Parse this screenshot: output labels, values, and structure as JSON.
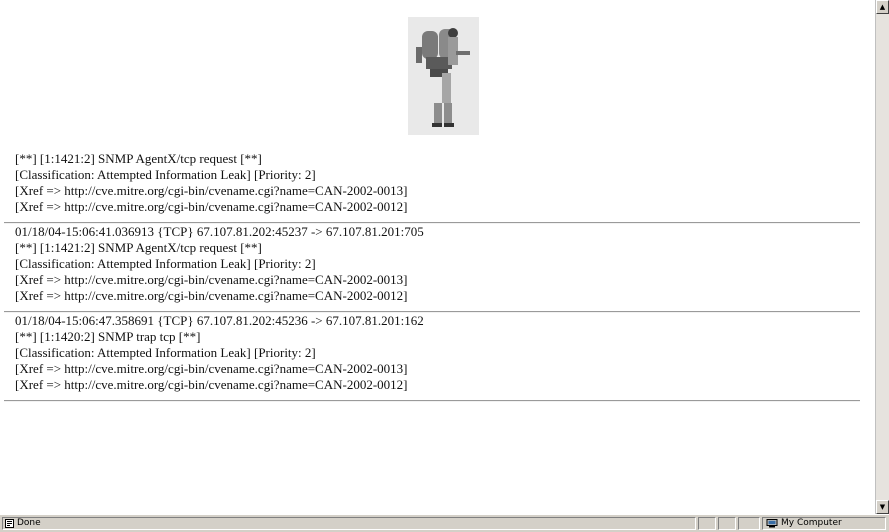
{
  "alerts": [
    {
      "lines": [
        "[**] [1:1421:2] SNMP AgentX/tcp request [**]",
        "[Classification: Attempted Information Leak] [Priority: 2]",
        "[Xref => http://cve.mitre.org/cgi-bin/cvename.cgi?name=CAN-2002-0013]",
        "[Xref => http://cve.mitre.org/cgi-bin/cvename.cgi?name=CAN-2002-0012]"
      ]
    },
    {
      "lines": [
        "01/18/04-15:06:41.036913 {TCP} 67.107.81.202:45237 -> 67.107.81.201:705",
        "[**] [1:1421:2] SNMP AgentX/tcp request [**]",
        "[Classification: Attempted Information Leak] [Priority: 2]",
        "[Xref => http://cve.mitre.org/cgi-bin/cvename.cgi?name=CAN-2002-0013]",
        "[Xref => http://cve.mitre.org/cgi-bin/cvename.cgi?name=CAN-2002-0012]"
      ]
    },
    {
      "lines": [
        "01/18/04-15:06:47.358691 {TCP} 67.107.81.202:45236 -> 67.107.81.201:162",
        "[**] [1:1420:2] SNMP trap tcp [**]",
        "[Classification: Attempted Information Leak] [Priority: 2]",
        "[Xref => http://cve.mitre.org/cgi-bin/cvename.cgi?name=CAN-2002-0013]",
        "[Xref => http://cve.mitre.org/cgi-bin/cvename.cgi?name=CAN-2002-0012]"
      ]
    }
  ],
  "statusbar": {
    "status_text": "Done",
    "zone_text": "My Computer"
  },
  "icons": {
    "page": "page-done-icon",
    "zone": "my-computer-icon",
    "scroll_up": "scroll-up-arrow-icon",
    "scroll_down": "scroll-down-arrow-icon"
  }
}
